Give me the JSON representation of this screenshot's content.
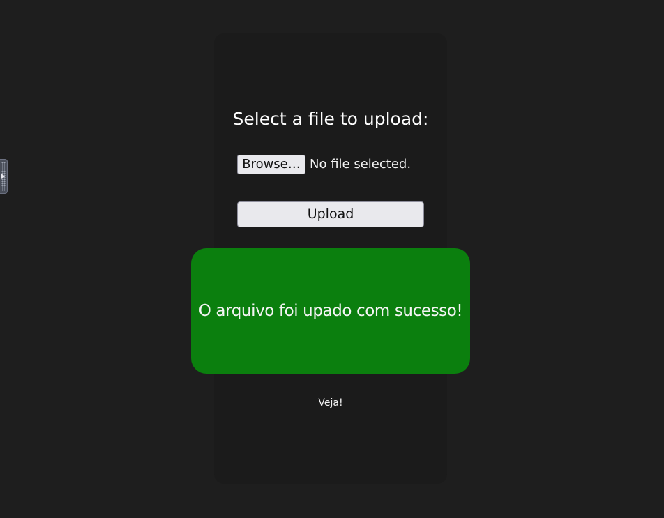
{
  "upload_form": {
    "title": "Select a file to upload:",
    "browse_label": "Browse…",
    "file_status": "No file selected.",
    "upload_label": "Upload"
  },
  "result": {
    "message": "O arquivo foi upado com sucesso!",
    "link_text": "Veja!",
    "success_color": "#0b7f0e"
  },
  "side_panel": {
    "icon": "drag-handle-icon"
  }
}
